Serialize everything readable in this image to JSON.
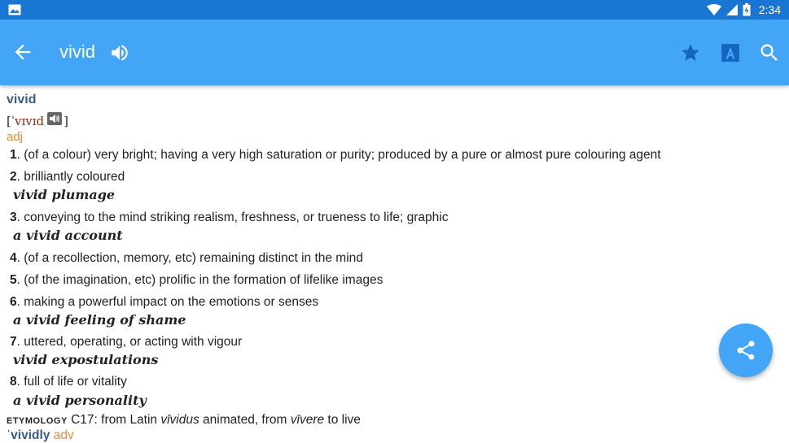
{
  "status_bar": {
    "time": "2:34",
    "icons": [
      "image-icon",
      "wifi-icon",
      "signal-icon",
      "battery-icon"
    ]
  },
  "app_bar": {
    "title": "vivid",
    "icons": [
      "back-arrow-icon",
      "speaker-icon",
      "star-icon",
      "font-a-icon",
      "search-icon"
    ],
    "background": "#42a5f5"
  },
  "entry": {
    "headword": "vivid",
    "pron_open": "[",
    "ipa": "ˈvɪvɪd",
    "pron_close": "]",
    "pos": "adj",
    "senses": [
      {
        "num": "1",
        "text": ". (of a colour) very bright; having a very high saturation or purity; produced by a pure or almost pure colouring agent",
        "example": ""
      },
      {
        "num": "2",
        "text": ". brilliantly coloured",
        "example": "vivid plumage"
      },
      {
        "num": "3",
        "text": ". conveying to the mind striking realism, freshness, or trueness to life; graphic",
        "example": "a vivid account"
      },
      {
        "num": "4",
        "text": ". (of a recollection, memory, etc) remaining distinct in the mind",
        "example": ""
      },
      {
        "num": "5",
        "text": ". (of the imagination, etc) prolific in the formation of lifelike images",
        "example": ""
      },
      {
        "num": "6",
        "text": ". making a powerful impact on the emotions or senses",
        "example": "a vivid feeling of shame"
      },
      {
        "num": "7",
        "text": ". uttered, operating, or acting with vigour",
        "example": "vivid expostulations"
      },
      {
        "num": "8",
        "text": ". full of life or vitality",
        "example": "a vivid personality"
      }
    ],
    "etymology": {
      "label": "ETYMOLOGY",
      "part1": " C17: from Latin ",
      "latin1": "vīvidus",
      "part2": " animated, from ",
      "latin2": "vīvere",
      "part3": " to live"
    },
    "derivative": {
      "word": "ˈvividly",
      "pos": " adv"
    }
  },
  "colors": {
    "status_bar": "#1976d2",
    "headword": "#3a5a8c",
    "pos": "#e8893a",
    "ipa": "#8b2d1a",
    "fab": "#42a5f5"
  },
  "fab": {
    "icon": "share-icon"
  }
}
